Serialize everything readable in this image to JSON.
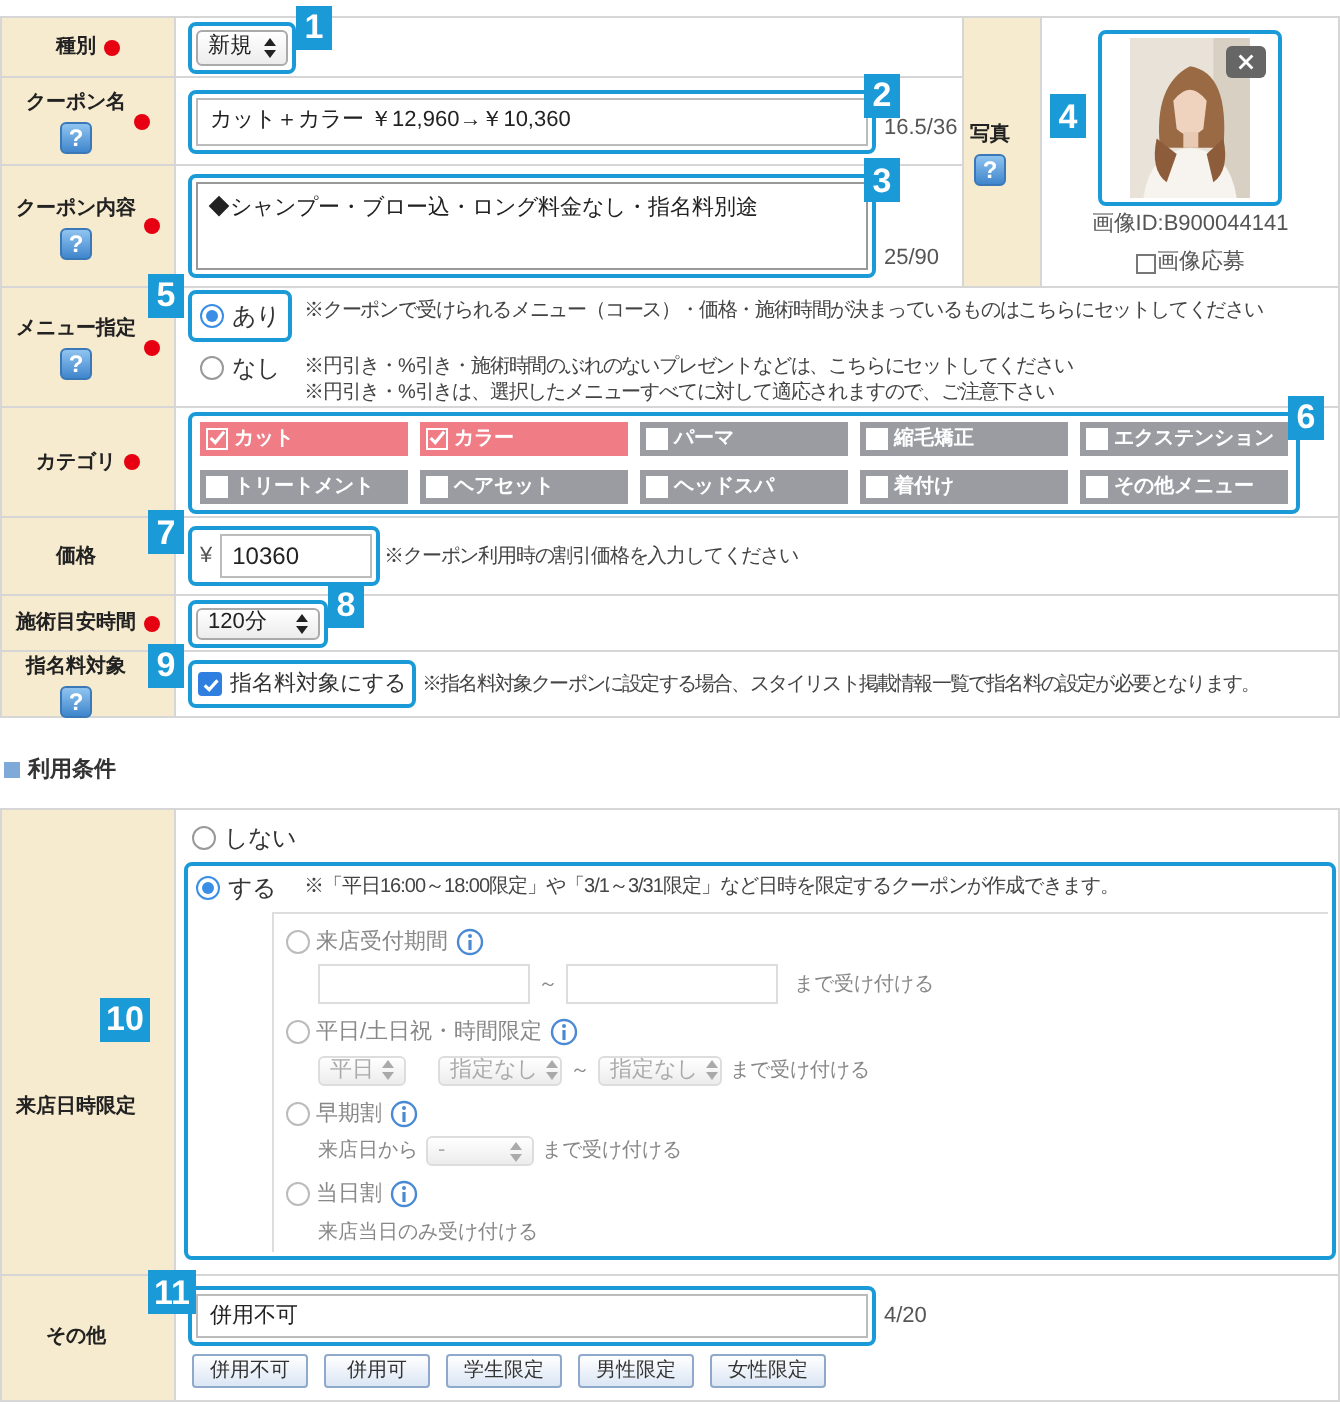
{
  "coupon_form": {
    "kind_row": {
      "label": "種別",
      "required": true,
      "value": "新規",
      "callout": "1"
    },
    "name_row": {
      "label": "クーポン名",
      "required": true,
      "help": "?",
      "value": "カット＋カラー ￥12,960→￥10,360",
      "counter": "16.5/36",
      "callout": "2"
    },
    "content_row": {
      "label": "クーポン内容",
      "required": true,
      "help": "?",
      "value": "◆シャンプー・ブロー込・ロング料金なし・指名料別途",
      "counter": "25/90",
      "callout": "3"
    },
    "photo": {
      "label": "写真",
      "help": "?",
      "image_id": "画像ID:B900044141",
      "apply": {
        "label": "画像応募",
        "checked": false
      },
      "callout": "4"
    },
    "menu_row": {
      "label": "メニュー指定",
      "required": true,
      "help": "?",
      "callout": "5",
      "options": [
        {
          "label": "あり",
          "selected": true,
          "notes": [
            "※クーポンで受けられるメニュー（コース）・価格・施術時間が決まっているものはこちらにセットしてください"
          ]
        },
        {
          "label": "なし",
          "selected": false,
          "notes": [
            "※円引き・%引き・施術時間のぶれのないプレゼントなどは、こちらにセットしてください",
            "※円引き・%引きは、選択したメニューすべてに対して適応されますので、ご注意下さい"
          ]
        }
      ]
    },
    "category_row": {
      "label": "カテゴリ",
      "required": true,
      "callout": "6",
      "items": [
        {
          "label": "カット",
          "checked": true
        },
        {
          "label": "カラー",
          "checked": true
        },
        {
          "label": "パーマ",
          "checked": false
        },
        {
          "label": "縮毛矯正",
          "checked": false
        },
        {
          "label": "エクステンション",
          "checked": false
        },
        {
          "label": "トリートメント",
          "checked": false
        },
        {
          "label": "ヘアセット",
          "checked": false
        },
        {
          "label": "ヘッドスパ",
          "checked": false
        },
        {
          "label": "着付け",
          "checked": false
        },
        {
          "label": "その他メニュー",
          "checked": false
        }
      ]
    },
    "price_row": {
      "label": "価格",
      "currency": "¥",
      "value": "10360",
      "note": "※クーポン利用時の割引価格を入力してください",
      "callout": "7"
    },
    "duration_row": {
      "label": "施術目安時間",
      "required": true,
      "value": "120分",
      "callout": "8"
    },
    "nomination_row": {
      "label": "指名料対象",
      "help": "?",
      "checkbox": {
        "label": "指名料対象にする",
        "checked": true
      },
      "note": "※指名料対象クーポンに設定する場合、スタイリスト掲載情報一覧で指名料の設定が必要となります。",
      "callout": "9"
    }
  },
  "conditions": {
    "heading": "利用条件",
    "visit_row": {
      "label": "来店日時限定",
      "options": [
        {
          "label": "しない",
          "selected": false
        },
        {
          "label": "する",
          "selected": true,
          "note": "※「平日16:00～18:00限定」や「3/1～3/31限定」など日時を限定するクーポンが作成できます。",
          "callout": "10"
        }
      ],
      "sub_options": [
        {
          "kind": "range_inputs",
          "label": "来店受付期間",
          "selected": false,
          "disabled": true,
          "separator": "～",
          "suffix": "まで受け付ける"
        },
        {
          "kind": "range_selects",
          "label": "平日/土日祝・時間限定",
          "selected": false,
          "disabled": true,
          "day": "平日",
          "from": "指定なし",
          "separator": "～",
          "to": "指定なし",
          "suffix": "まで受け付ける"
        },
        {
          "kind": "early",
          "label": "早期割",
          "selected": false,
          "disabled": true,
          "prefix": "来店日から",
          "select": "-",
          "suffix": "まで受け付ける"
        },
        {
          "kind": "same_day",
          "label": "当日割",
          "selected": false,
          "disabled": true,
          "note": "来店当日のみ受け付ける"
        }
      ]
    },
    "other_row": {
      "label": "その他",
      "value": "併用不可",
      "counter": "4/20",
      "callout": "11",
      "presets": [
        "併用不可",
        "併用可",
        "学生限定",
        "男性限定",
        "女性限定"
      ]
    }
  }
}
